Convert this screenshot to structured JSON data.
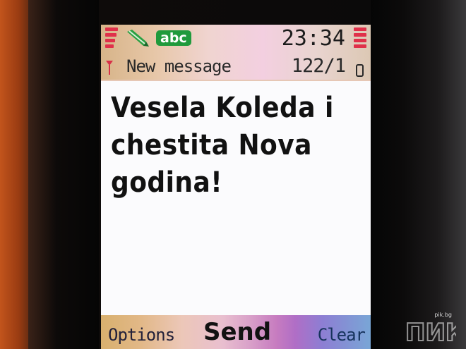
{
  "status": {
    "mode": "abc",
    "time": "23:34",
    "title": "New message",
    "counter": "122/1",
    "icons": [
      "signal-strength-icon",
      "battery-level-icon",
      "pen-icon",
      "antenna-icon",
      "battery-empty-icon"
    ],
    "signal_bars": 4,
    "battery_bars": 4
  },
  "message": {
    "text": "Vesela Koleda i\nchestita Nova\ngodina!"
  },
  "softkeys": {
    "left": "Options",
    "middle": "Send",
    "right": "Clear"
  },
  "watermark": {
    "site": "pik.bg",
    "logo": "ПИК"
  },
  "colors": {
    "signal": "#e0304a",
    "mode_badge": "#1f9a3c",
    "screen_bg": "#fbfbfd"
  }
}
